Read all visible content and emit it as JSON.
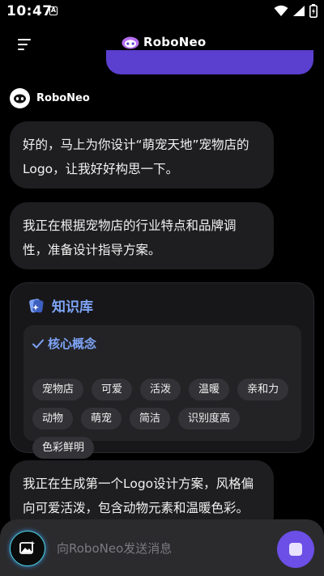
{
  "status_bar": {
    "time": "10:47",
    "notification_icon": "A",
    "icons": [
      "wifi-icon",
      "signal-icon",
      "battery-charging-icon"
    ]
  },
  "header": {
    "app_name": "RoboNeo",
    "menu_icon": "menu-icon"
  },
  "bot": {
    "name": "RoboNeo"
  },
  "messages": [
    {
      "text": "好的，马上为你设计“萌宠天地”宠物店的Logo，让我好好构思一下。"
    },
    {
      "text": "我正在根据宠物店的行业特点和品牌调性，准备设计指导方案。"
    },
    {
      "text": "我正在生成第一个Logo设计方案，风格偏向可爱活泼，包含动物元素和温暖色彩。"
    }
  ],
  "knowledge_base": {
    "title": "知识库",
    "section_title": "核心概念",
    "tags": [
      "宠物店",
      "可爱",
      "活泼",
      "温暖",
      "亲和力",
      "动物",
      "萌宠",
      "简洁",
      "识别度高",
      "色彩鲜明"
    ]
  },
  "input": {
    "placeholder": "向RoboNeo发送消息"
  },
  "colors": {
    "accent_purple": "#6b4fe6",
    "kb_blue": "#7ea4f6",
    "bubble_bg": "#1e1e20"
  }
}
